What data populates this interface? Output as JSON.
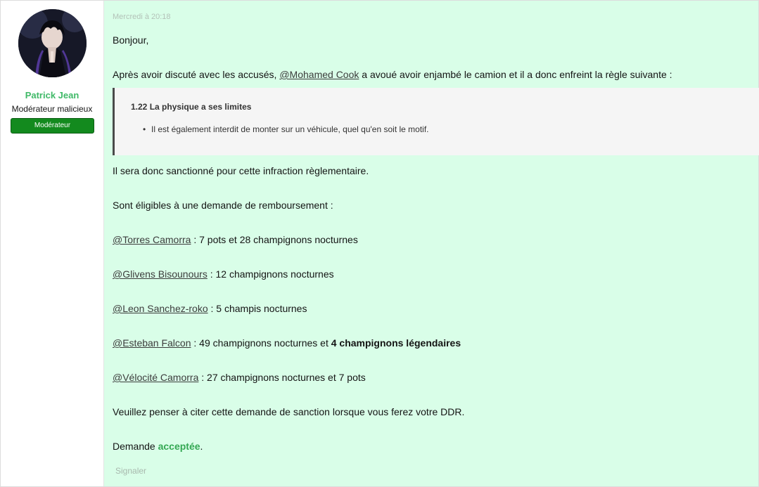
{
  "user": {
    "name": "Patrick Jean",
    "title": "Modérateur malicieux",
    "banner": "Modérateur",
    "avatar_icon": "user-avatar-icon"
  },
  "post": {
    "timestamp": "Mercredi à 20:18",
    "greeting": "Bonjour,",
    "intro_before": "Après avoir discuté avec les accusés, ",
    "intro_mention": "@Mohamed Cook",
    "intro_after": " a avoué avoir enjambé le camion et il a donc enfreint la règle suivante :",
    "quote_title": "1.22 La physique a ses limites",
    "quote_item": "Il est également interdit de monter sur un véhicule, quel qu'en soit le motif.",
    "sanction_text": "Il sera donc sanctionné pour cette infraction règlementaire.",
    "refund_intro": "Sont éligibles à une demande de remboursement :",
    "refunds": [
      {
        "mention": "@Torres Camorra",
        "text": " : 7 pots et 28 champignons nocturnes",
        "bold": ""
      },
      {
        "mention": "@Glivens Bisounours",
        "text": " : 12 champignons nocturnes",
        "bold": ""
      },
      {
        "mention": "@Leon Sanchez-roko",
        "text": " : 5 champis nocturnes",
        "bold": ""
      },
      {
        "mention": "@Esteban Falcon",
        "text": " : 49 champignons nocturnes et ",
        "bold": "4 champignons légendaires"
      },
      {
        "mention": "@Vélocité Camorra",
        "text": " : 27 champignons nocturnes et 7 pots",
        "bold": ""
      }
    ],
    "reminder": "Veuillez penser à citer cette demande de sanction lorsque vous ferez votre DDR.",
    "decision_before": "Demande ",
    "decision_status": "acceptée",
    "decision_after": ".",
    "report_label": "Signaler"
  },
  "colors": {
    "main_bg": "#d9fee8",
    "username": "#3fb967",
    "banner_bg": "#138a1e",
    "accepted": "#34a853"
  }
}
